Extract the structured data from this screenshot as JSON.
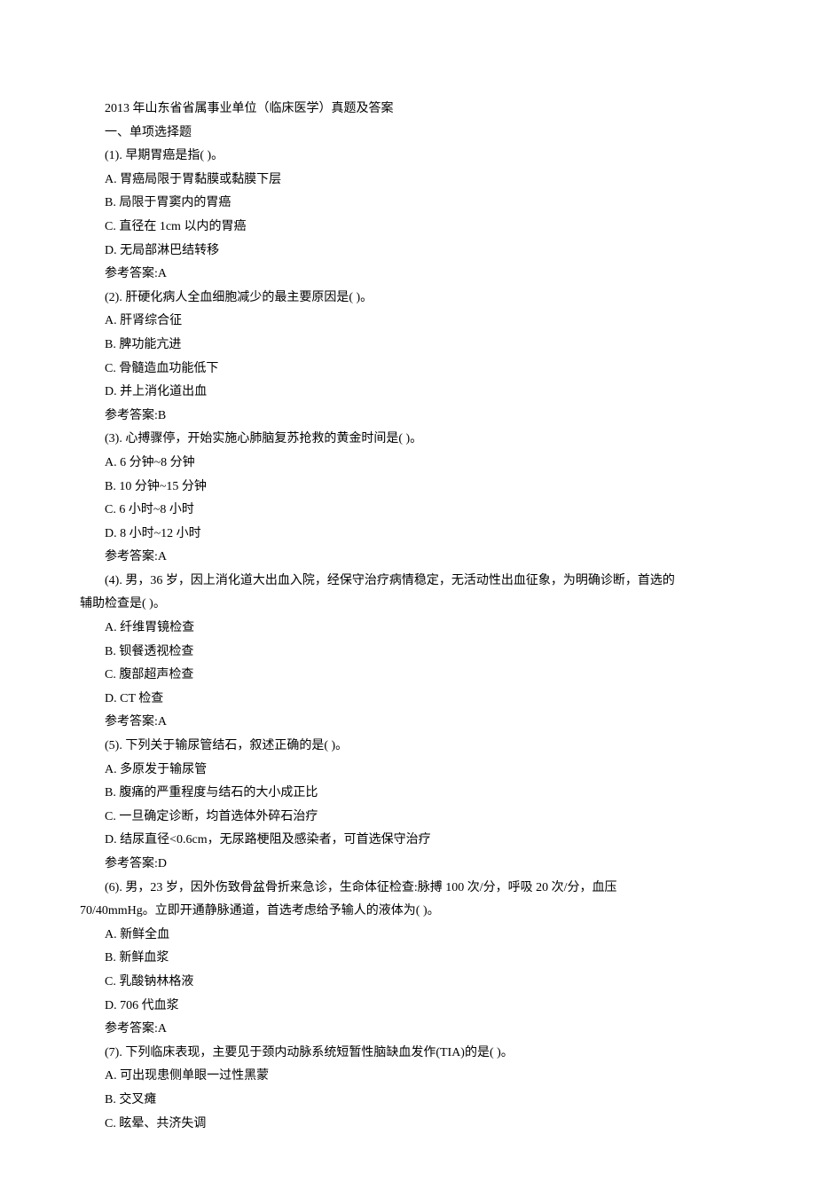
{
  "title": "2013 年山东省省属事业单位（临床医学）真题及答案",
  "section_heading": "一、单项选择题",
  "questions": [
    {
      "stem": "(1). 早期胃癌是指( )。",
      "options": [
        "A. 胃癌局限于胃黏膜或黏膜下层",
        "B. 局限于胃窦内的胃癌",
        "C. 直径在 1cm 以内的胃癌",
        "D. 无局部淋巴结转移"
      ],
      "answer": "参考答案:A"
    },
    {
      "stem": "(2). 肝硬化病人全血细胞减少的最主要原因是( )。",
      "options": [
        "A. 肝肾综合征",
        "B. 脾功能亢进",
        "C. 骨髓造血功能低下",
        "D. 并上消化道出血"
      ],
      "answer": "参考答案:B"
    },
    {
      "stem": "(3). 心搏骤停，开始实施心肺脑复苏抢救的黄金时间是( )。",
      "options": [
        "A. 6 分钟~8 分钟",
        "B. 10 分钟~15 分钟",
        "C. 6 小时~8 小时",
        "D. 8 小时~12 小时"
      ],
      "answer": "参考答案:A"
    },
    {
      "stem": "(4). 男，36 岁，因上消化道大出血入院，经保守治疗病情稳定，无活动性出血征象，为明确诊断，首选的",
      "stem_wrap": "辅助检查是( )。",
      "options": [
        "A. 纤维胃镜检查",
        "B. 钡餐透视检查",
        "C. 腹部超声检查",
        "D. CT 检查"
      ],
      "answer": "参考答案:A"
    },
    {
      "stem": "(5). 下列关于输尿管结石，叙述正确的是( )。",
      "options": [
        "A. 多原发于输尿管",
        "B. 腹痛的严重程度与结石的大小成正比",
        "C. 一旦确定诊断，均首选体外碎石治疗",
        "D. 结尿直径<0.6cm，无尿路梗阻及感染者，可首选保守治疗"
      ],
      "answer": "参考答案:D"
    },
    {
      "stem": "(6). 男，23 岁，因外伤致骨盆骨折来急诊，生命体征检查:脉搏 100 次/分，呼吸 20 次/分，血压",
      "stem_wrap": "70/40mmHg。立即开通静脉通道，首选考虑给予输人的液体为( )。",
      "options": [
        "A. 新鲜全血",
        "B. 新鲜血浆",
        "C. 乳酸钠林格液",
        "D. 706 代血浆"
      ],
      "answer": "参考答案:A"
    },
    {
      "stem": "(7). 下列临床表现，主要见于颈内动脉系统短暂性脑缺血发作(TIA)的是( )。",
      "options": [
        "A. 可出现患侧单眼一过性黑蒙",
        "B. 交叉瘫",
        "C. 眩晕、共济失调"
      ]
    }
  ]
}
